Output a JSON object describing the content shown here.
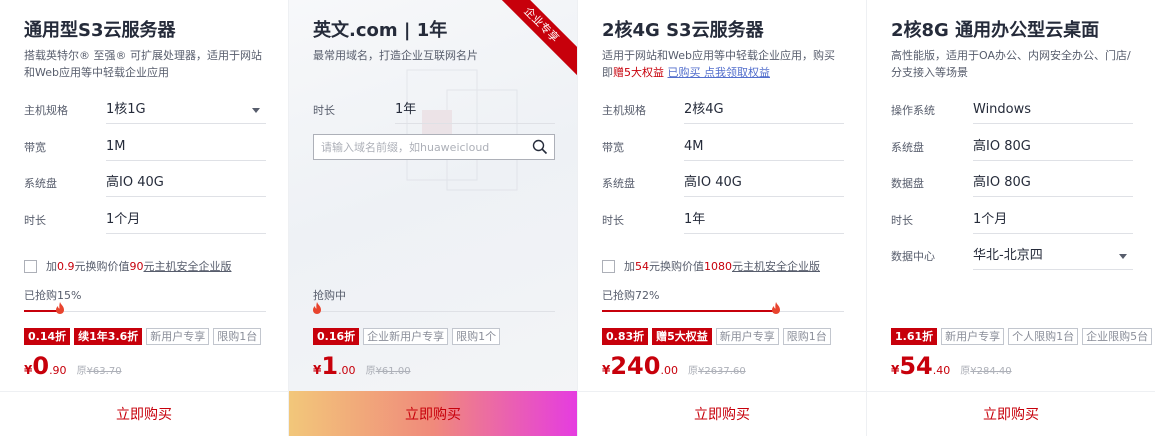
{
  "cards": [
    {
      "title": "通用型S3云服务器",
      "desc": "搭载英特尔® 至强® 可扩展处理器，适用于网站和Web应用等中轻载企业应用",
      "specs": [
        {
          "label": "主机规格",
          "value": "1核1G",
          "dropdown": true
        },
        {
          "label": "带宽",
          "value": "1M"
        },
        {
          "label": "系统盘",
          "value": "高IO 40G"
        },
        {
          "label": "时长",
          "value": "1个月"
        }
      ],
      "addon": {
        "prefix": "加",
        "amount": "0.9",
        "mid": "元换购价值",
        "value": "90",
        "suffix": "元主机安全企业版"
      },
      "progress": {
        "text": "已抢购15%",
        "percent": 15
      },
      "tags": {
        "discount": "0.14折",
        "promo": "续1年3.6折",
        "outline": [
          "新用户专享",
          "限购1台"
        ]
      },
      "price": {
        "currency": "¥",
        "integer": "0",
        "decimal": ".90",
        "original": "¥63.70"
      },
      "buy_label": "立即购买"
    },
    {
      "title": "英文.com | 1年",
      "desc": "最常用域名，打造企业互联网名片",
      "ribbon": "企业专享",
      "specs": [
        {
          "label": "时长",
          "value": "1年"
        }
      ],
      "search_placeholder": "请输入域名前缀，如huaweicloud",
      "progress": {
        "text": "抢购中",
        "percent": 0
      },
      "tags": {
        "discount": "0.16折",
        "outline": [
          "企业新用户专享",
          "限购1个"
        ]
      },
      "price": {
        "currency": "¥",
        "integer": "1",
        "decimal": ".00",
        "original": "¥61.00"
      },
      "buy_label": "立即购买"
    },
    {
      "title": "2核4G S3云服务器",
      "desc_pre": "适用于网站和Web应用等中轻载企业应用，购买即",
      "desc_red": "赠5大权益",
      "desc_link": "已购买 点我领取权益",
      "specs": [
        {
          "label": "主机规格",
          "value": "2核4G"
        },
        {
          "label": "带宽",
          "value": "4M"
        },
        {
          "label": "系统盘",
          "value": "高IO 40G"
        },
        {
          "label": "时长",
          "value": "1年"
        }
      ],
      "addon": {
        "prefix": "加",
        "amount": "54",
        "mid": "元换购价值",
        "value": "1080",
        "suffix": "元主机安全企业版"
      },
      "progress": {
        "text": "已抢购72%",
        "percent": 72
      },
      "tags": {
        "discount": "0.83折",
        "promo": "赠5大权益",
        "outline": [
          "新用户专享",
          "限购1台"
        ]
      },
      "price": {
        "currency": "¥",
        "integer": "240",
        "decimal": ".00",
        "original": "¥2637.60"
      },
      "buy_label": "立即购买"
    },
    {
      "title": "2核8G 通用办公型云桌面",
      "desc": "高性能版，适用于OA办公、内网安全办公、门店/分支接入等场景",
      "specs": [
        {
          "label": "操作系统",
          "value": "Windows"
        },
        {
          "label": "系统盘",
          "value": "高IO 80G"
        },
        {
          "label": "数据盘",
          "value": "高IO 80G"
        },
        {
          "label": "时长",
          "value": "1个月"
        },
        {
          "label": "数据中心",
          "value": "华北-北京四",
          "dropdown": true
        }
      ],
      "tags": {
        "discount": "1.61折",
        "outline": [
          "新用户专享",
          "个人限购1台",
          "企业限购5台"
        ]
      },
      "price": {
        "currency": "¥",
        "integer": "54",
        "decimal": ".40",
        "original": "¥284.40"
      },
      "buy_label": "立即购买"
    }
  ],
  "colors": {
    "accent": "#c7000b",
    "link": "#526ecc",
    "border": "#dfe1e6"
  },
  "icons": {
    "search": "search-icon",
    "flame": "flame-icon",
    "dropdown": "caret-down-icon"
  }
}
